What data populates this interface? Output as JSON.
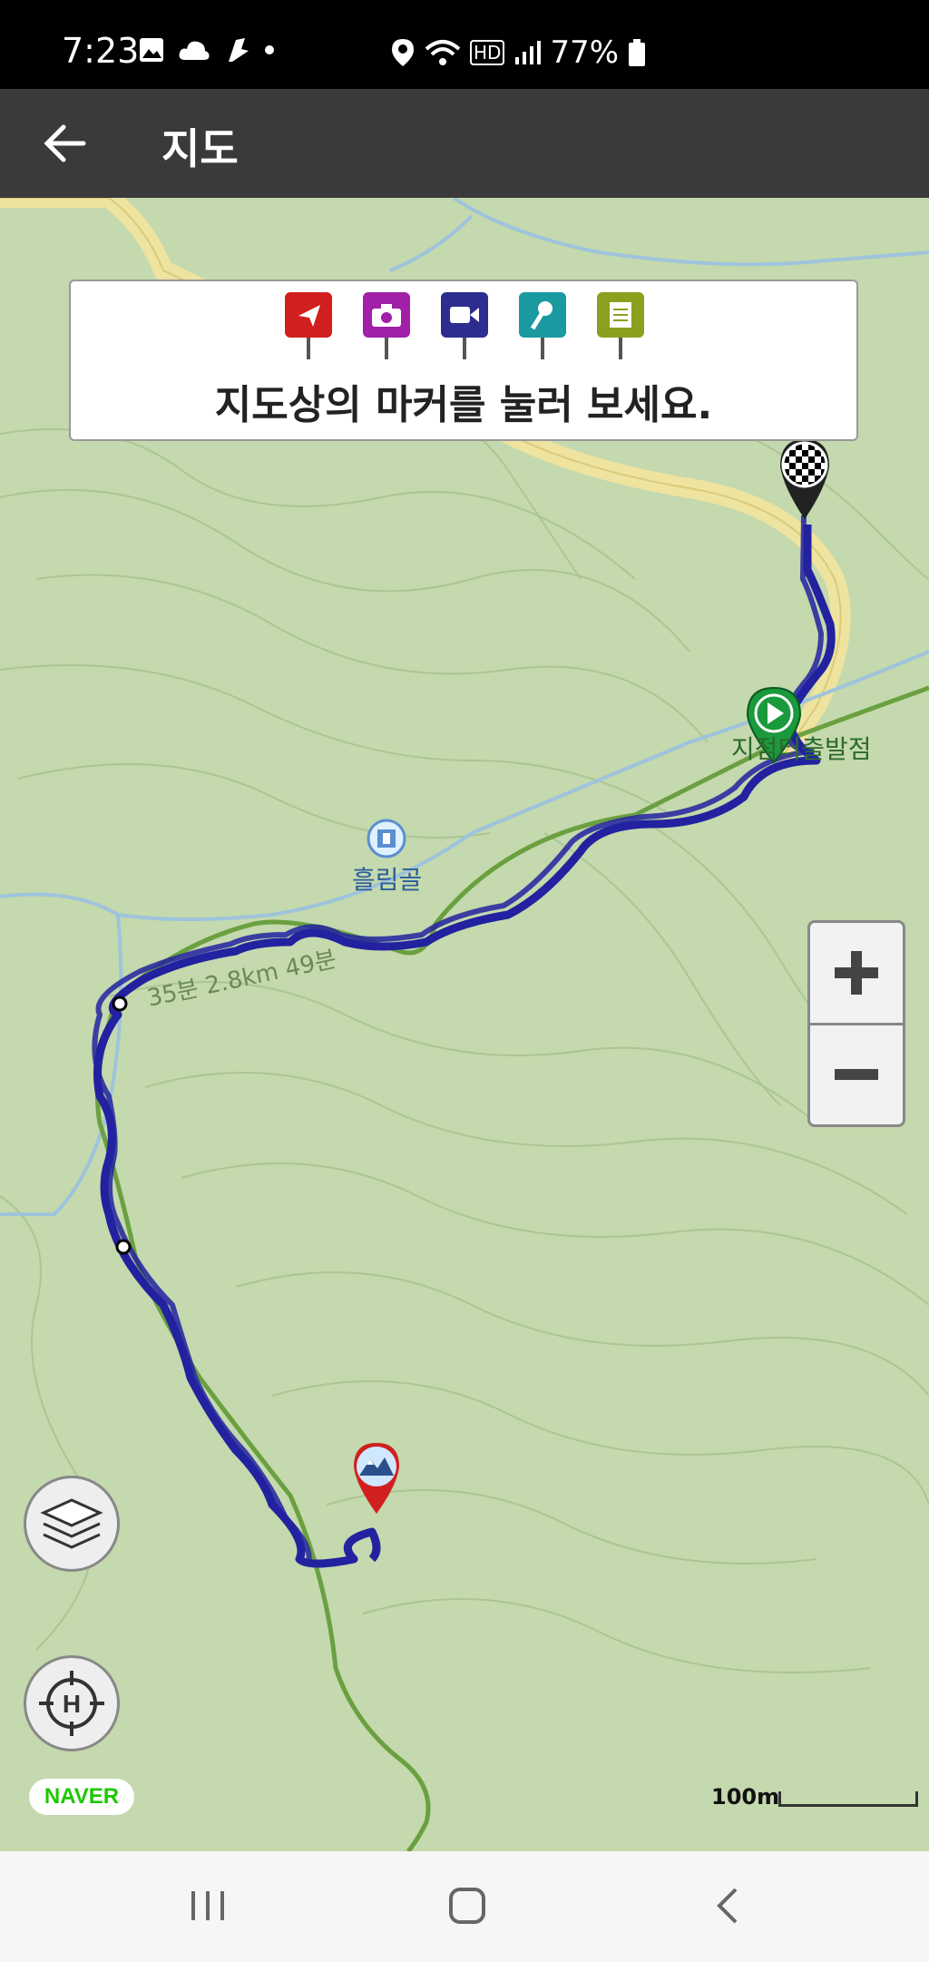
{
  "status": {
    "time": "7:23",
    "network": "HD",
    "battery": "77%"
  },
  "appbar": {
    "title": "지도"
  },
  "hint": {
    "message": "지도상의 마커를 눌러 보세요.",
    "markers": [
      {
        "name": "flag-icon",
        "color": "#d11f1f"
      },
      {
        "name": "camera-icon",
        "color": "#a020a8"
      },
      {
        "name": "video-icon",
        "color": "#2d2d8f"
      },
      {
        "name": "microphone-icon",
        "color": "#1a9aa0"
      },
      {
        "name": "note-icon",
        "color": "#8aa01e"
      }
    ]
  },
  "map": {
    "place_label": "흘림골",
    "start_label": "지점터출발점",
    "route_label": "35분 2.8km 49분",
    "scale_label": "100m",
    "provider": "NAVER",
    "route_color": "#2222a0",
    "trail_color": "#6aa040"
  },
  "zoom": {
    "plus": "+",
    "minus": "−"
  }
}
